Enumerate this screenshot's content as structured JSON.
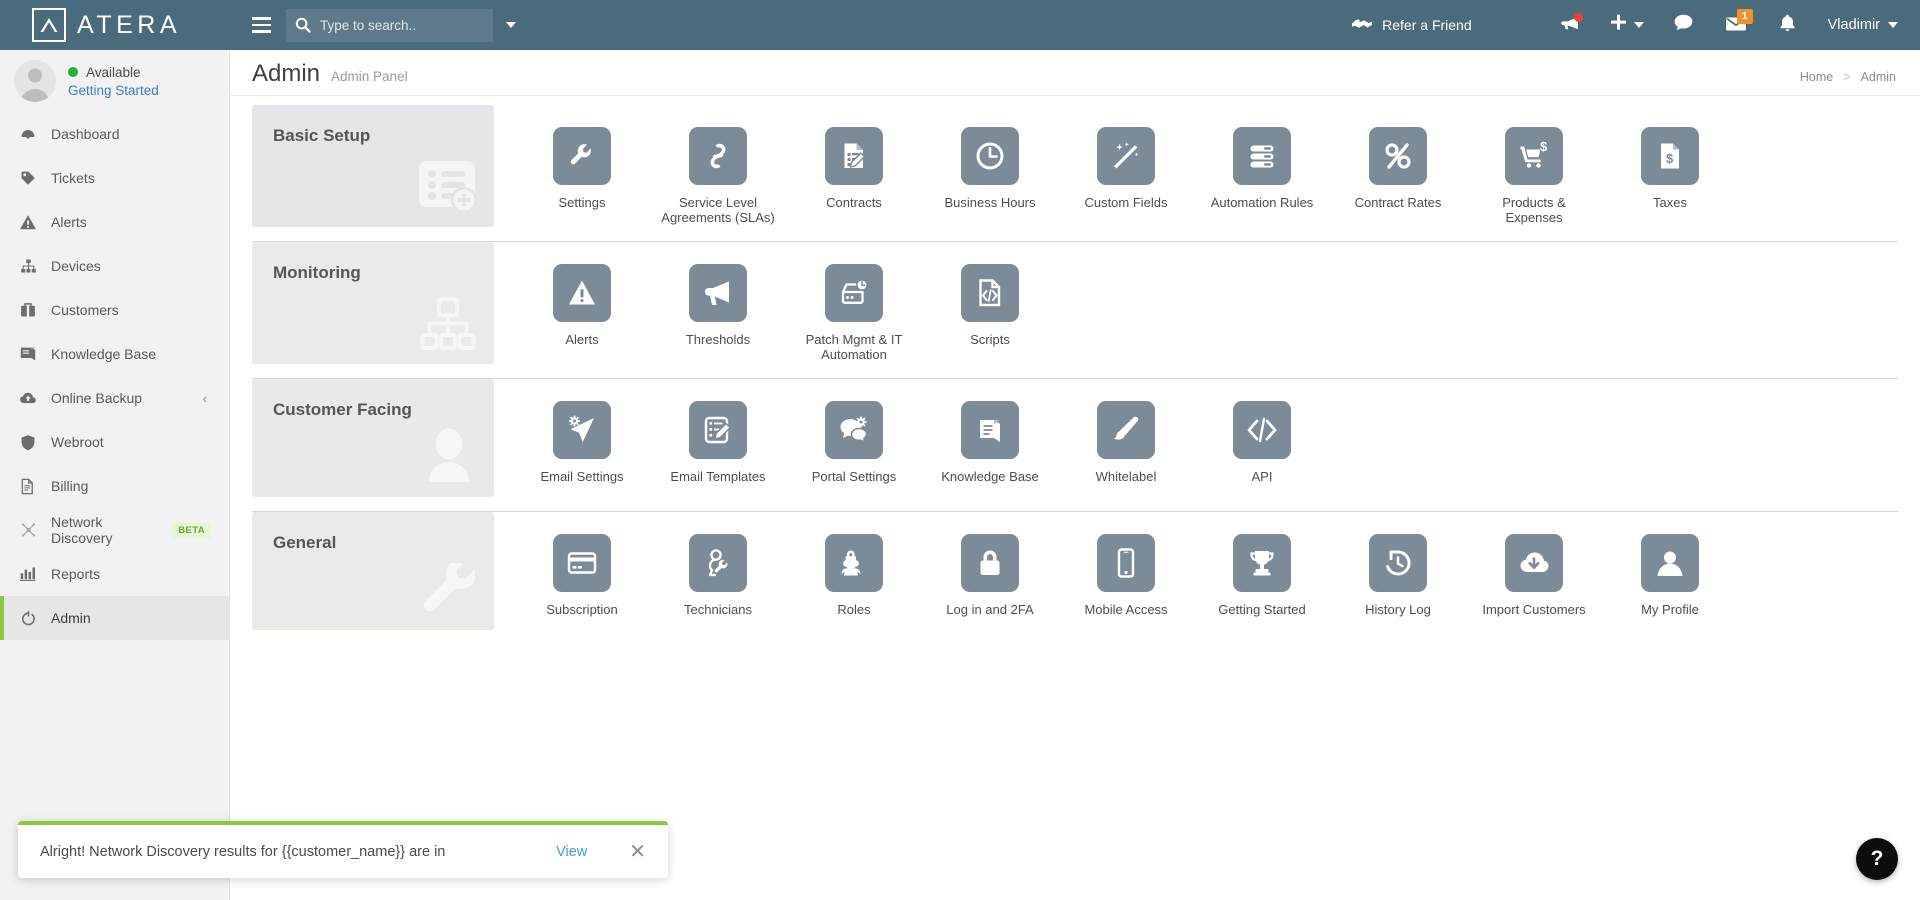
{
  "brand": {
    "name": "ATERA",
    "logo_icon": "atera-chevron-logo"
  },
  "colors": {
    "header_bg": "#4a6b7c",
    "accent_green": "#8dc63f",
    "tile_bg": "#7c8b98",
    "link_blue": "#3d7fc1",
    "badge_orange": "#f0932b",
    "alert_red": "#ef3e36"
  },
  "search": {
    "placeholder": "Type to search..",
    "value": "",
    "icon": "search-icon"
  },
  "header": {
    "menu_icon": "hamburger-icon",
    "refer_label": "Refer a Friend",
    "refer_icon": "handshake-icon",
    "announcement_icon": "megaphone-icon",
    "add_icon": "plus-icon",
    "chat_icon": "chat-bubble-icon",
    "mail_icon": "envelope-icon",
    "mail_badge": "1",
    "bell_icon": "bell-icon",
    "user_name": "Vladimir"
  },
  "sidebar": {
    "profile": {
      "avatar_icon": "user-avatar-icon",
      "status": "Available",
      "getting_started": "Getting Started"
    },
    "items": [
      {
        "label": "Dashboard",
        "icon": "speedometer-icon",
        "active": false,
        "badge": "",
        "chevron": false
      },
      {
        "label": "Tickets",
        "icon": "tag-icon",
        "active": false,
        "badge": "",
        "chevron": false
      },
      {
        "label": "Alerts",
        "icon": "warning-icon",
        "active": false,
        "badge": "",
        "chevron": false
      },
      {
        "label": "Devices",
        "icon": "sitemap-icon",
        "active": false,
        "badge": "",
        "chevron": false
      },
      {
        "label": "Customers",
        "icon": "briefcase-icon",
        "active": false,
        "badge": "",
        "chevron": false
      },
      {
        "label": "Knowledge Base",
        "icon": "book-icon",
        "active": false,
        "badge": "",
        "chevron": false
      },
      {
        "label": "Online Backup",
        "icon": "cloud-icon",
        "active": false,
        "badge": "",
        "chevron": true
      },
      {
        "label": "Webroot",
        "icon": "shield-icon",
        "active": false,
        "badge": "",
        "chevron": false
      },
      {
        "label": "Billing",
        "icon": "document-icon",
        "active": false,
        "badge": "",
        "chevron": false
      },
      {
        "label": "Network Discovery",
        "icon": "network-scan-icon",
        "active": false,
        "badge": "BETA",
        "chevron": false
      },
      {
        "label": "Reports",
        "icon": "bar-chart-icon",
        "active": false,
        "badge": "",
        "chevron": false
      },
      {
        "label": "Admin",
        "icon": "power-circle-icon",
        "active": true,
        "badge": "",
        "chevron": false
      }
    ]
  },
  "page": {
    "title": "Admin",
    "subtitle": "Admin Panel",
    "breadcrumb": {
      "home": "Home",
      "separator": ">",
      "current": "Admin"
    }
  },
  "sections": [
    {
      "title": "Basic Setup",
      "deco_icon": "list-add-icon",
      "items": [
        {
          "label": "Settings",
          "icon": "wrench-icon"
        },
        {
          "label": "Service Level Agreements (SLAs)",
          "icon": "link-chain-icon"
        },
        {
          "label": "Contracts",
          "icon": "document-edit-icon"
        },
        {
          "label": "Business Hours",
          "icon": "clock-icon"
        },
        {
          "label": "Custom Fields",
          "icon": "magic-wand-icon"
        },
        {
          "label": "Automation Rules",
          "icon": "server-rules-icon"
        },
        {
          "label": "Contract Rates",
          "icon": "percent-icon"
        },
        {
          "label": "Products & Expenses",
          "icon": "cart-dollar-icon"
        },
        {
          "label": "Taxes",
          "icon": "document-dollar-icon"
        }
      ]
    },
    {
      "title": "Monitoring",
      "deco_icon": "network-tree-icon",
      "items": [
        {
          "label": "Alerts",
          "icon": "warning-triangle-icon"
        },
        {
          "label": "Thresholds",
          "icon": "megaphone-icon"
        },
        {
          "label": "Patch Mgmt & IT Automation",
          "icon": "disk-clock-icon"
        },
        {
          "label": "Scripts",
          "icon": "code-document-icon"
        }
      ]
    },
    {
      "title": "Customer Facing",
      "deco_icon": "user-silhouette-icon",
      "items": [
        {
          "label": "Email Settings",
          "icon": "send-gear-icon"
        },
        {
          "label": "Email Templates",
          "icon": "template-edit-icon"
        },
        {
          "label": "Portal Settings",
          "icon": "chat-gear-icon"
        },
        {
          "label": "Knowledge Base",
          "icon": "book-icon"
        },
        {
          "label": "Whitelabel",
          "icon": "paintbrush-icon"
        },
        {
          "label": "API",
          "icon": "code-brackets-icon"
        }
      ]
    },
    {
      "title": "General",
      "deco_icon": "wrench-icon",
      "items": [
        {
          "label": "Subscription",
          "icon": "credit-card-icon"
        },
        {
          "label": "Technicians",
          "icon": "technician-icon"
        },
        {
          "label": "Roles",
          "icon": "users-lock-icon"
        },
        {
          "label": "Log in and 2FA",
          "icon": "padlock-icon"
        },
        {
          "label": "Mobile Access",
          "icon": "mobile-phone-icon"
        },
        {
          "label": "Getting Started",
          "icon": "trophy-icon"
        },
        {
          "label": "History Log",
          "icon": "history-clock-icon"
        },
        {
          "label": "Import Customers",
          "icon": "cloud-download-icon"
        },
        {
          "label": "My Profile",
          "icon": "user-portrait-icon"
        }
      ]
    }
  ],
  "toast": {
    "message": "Alright! Network Discovery results for {{customer_name}} are in",
    "action": "View",
    "close_icon": "close-icon"
  },
  "help_button": {
    "label": "?",
    "icon": "question-mark-icon"
  }
}
